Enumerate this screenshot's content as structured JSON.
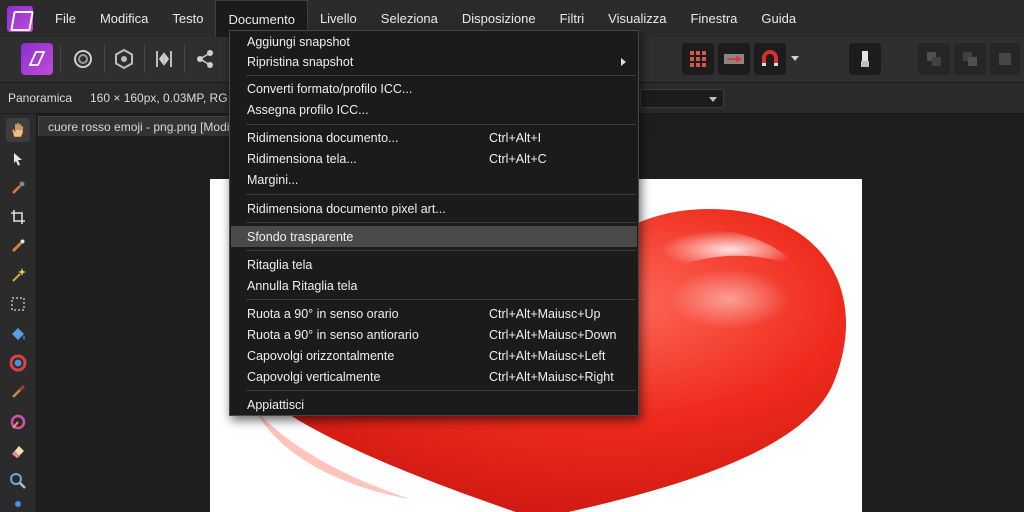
{
  "menubar": {
    "items": [
      {
        "label": "File"
      },
      {
        "label": "Modifica"
      },
      {
        "label": "Testo"
      },
      {
        "label": "Documento"
      },
      {
        "label": "Livello"
      },
      {
        "label": "Seleziona"
      },
      {
        "label": "Disposizione"
      },
      {
        "label": "Filtri"
      },
      {
        "label": "Visualizza"
      },
      {
        "label": "Finestra"
      },
      {
        "label": "Guida"
      }
    ],
    "active": "Documento"
  },
  "context": {
    "tool_name": "Panoramica",
    "doc_info": "160 × 160px, 0.03MP, RG"
  },
  "document_tab": {
    "title": "cuore rosso emoji - png.png [Modi"
  },
  "dropdown": {
    "items": [
      {
        "label": "Aggiungi snapshot",
        "shortcut": ""
      },
      {
        "label": "Ripristina snapshot",
        "shortcut": "",
        "submenu": true
      },
      {
        "label": "Converti formato/profilo ICC...",
        "shortcut": ""
      },
      {
        "label": "Assegna profilo ICC...",
        "shortcut": ""
      },
      {
        "label": "Ridimensiona documento...",
        "shortcut": "Ctrl+Alt+I"
      },
      {
        "label": "Ridimensiona tela...",
        "shortcut": "Ctrl+Alt+C"
      },
      {
        "label": "Margini...",
        "shortcut": ""
      },
      {
        "label": "Ridimensiona documento pixel art...",
        "shortcut": ""
      },
      {
        "label": "Sfondo trasparente",
        "shortcut": "",
        "highlighted": true
      },
      {
        "label": "Ritaglia tela",
        "shortcut": ""
      },
      {
        "label": "Annulla Ritaglia tela",
        "shortcut": ""
      },
      {
        "label": "Ruota a 90° in senso orario",
        "shortcut": "Ctrl+Alt+Maiusc+Up"
      },
      {
        "label": "Ruota a 90° in senso antiorario",
        "shortcut": "Ctrl+Alt+Maiusc+Down"
      },
      {
        "label": "Capovolgi orizzontalmente",
        "shortcut": "Ctrl+Alt+Maiusc+Left"
      },
      {
        "label": "Capovolgi verticalmente",
        "shortcut": "Ctrl+Alt+Maiusc+Right"
      },
      {
        "label": "Appiattisci",
        "shortcut": ""
      }
    ]
  },
  "icons": {
    "app": "affinity-photo-logo",
    "toolbar": [
      "photo-persona-icon",
      "liquify-persona-icon",
      "develop-persona-icon",
      "tone-mapping-persona-icon",
      "export-persona-icon",
      "snapping-grid-icon",
      "transparency-icon",
      "snapping-magnet-icon",
      "brush-icon",
      "arrange-icon"
    ],
    "tools": [
      "hand-icon",
      "move-icon",
      "color-picker-icon",
      "crop-icon",
      "selection-brush-icon",
      "magic-wand-icon",
      "marquee-icon",
      "fill-icon",
      "gradient-icon",
      "paint-brush-icon",
      "retouch-icon",
      "eraser-icon",
      "zoom-icon",
      "more-tools-icon"
    ]
  },
  "colors": {
    "accent": "#a040d8",
    "menu_highlight": "#4a4a4a",
    "heart_red": "#e01c1c"
  }
}
